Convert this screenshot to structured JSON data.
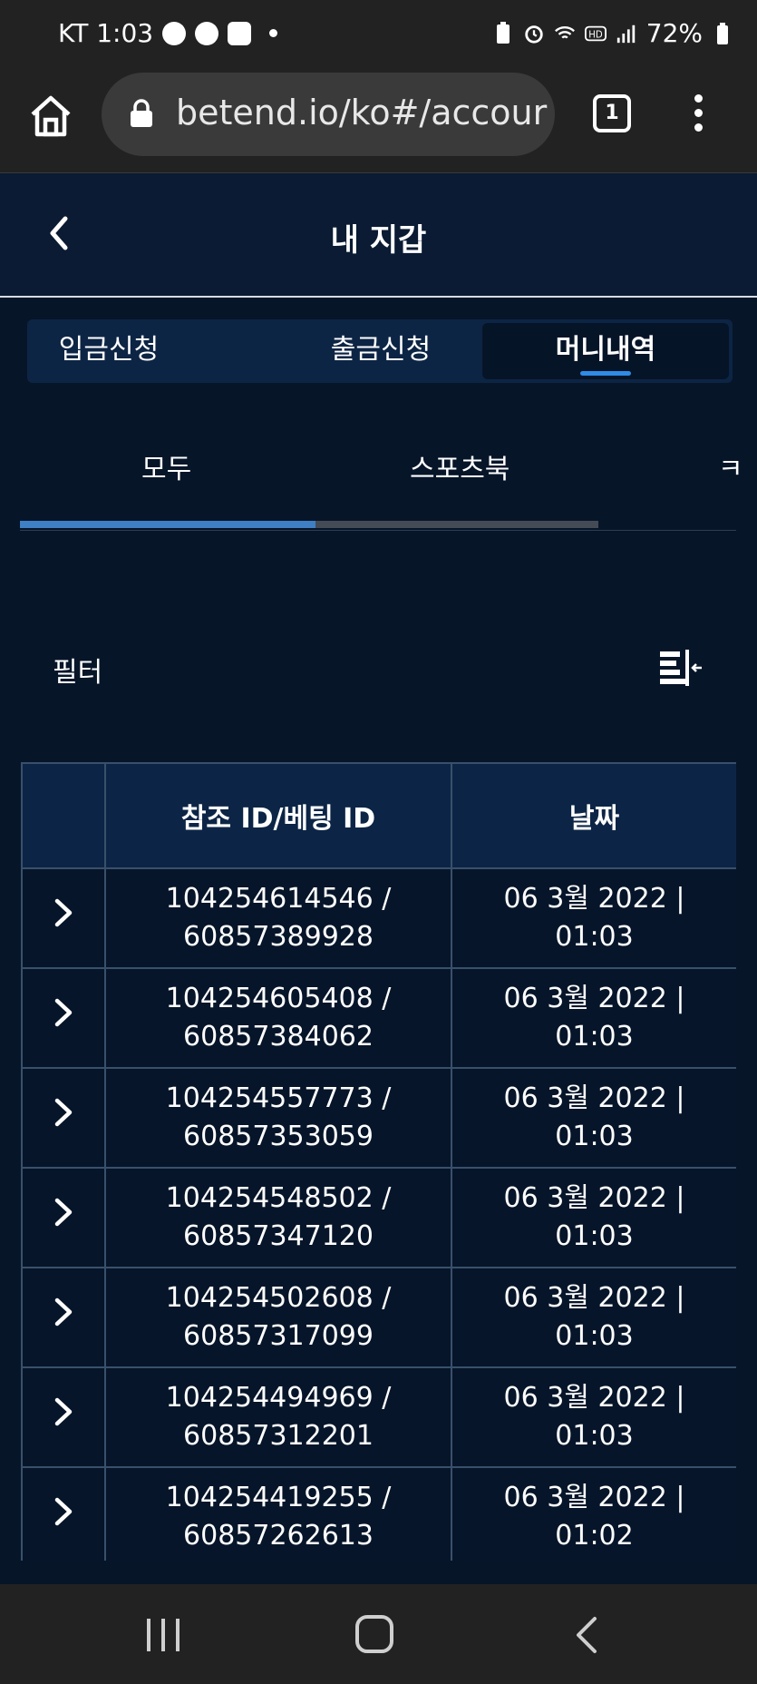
{
  "status_bar": {
    "carrier_time": "KT 1:03",
    "battery": "72%",
    "left_icons": [
      "n-badge-icon",
      "chat-bubble-icon",
      "timer-icon",
      "dot-icon"
    ],
    "right_icons": [
      "battery-saver-icon",
      "alarm-icon",
      "wifi-icon",
      "hd-icon",
      "signal-icon",
      "battery-icon"
    ]
  },
  "browser": {
    "url": "betend.io/ko#/accour",
    "tab_count": "1"
  },
  "header": {
    "title": "내 지갑"
  },
  "main_tabs": [
    {
      "label": "입금신청",
      "active": false
    },
    {
      "label": "출금신청",
      "active": false
    },
    {
      "label": "머니내역",
      "active": true
    }
  ],
  "sub_tabs": [
    {
      "label": "모두",
      "active": true
    },
    {
      "label": "스포츠북",
      "active": false
    },
    {
      "label": "ㅋ",
      "active": false
    }
  ],
  "filter": {
    "label": "필터"
  },
  "table": {
    "headers": [
      "",
      "참조 ID/베팅 ID",
      "날짜"
    ],
    "rows": [
      {
        "ref_id": "104254614546 /",
        "bet_id": "60857389928",
        "date": "06 3월 2022 |",
        "time": "01:03"
      },
      {
        "ref_id": "104254605408 /",
        "bet_id": "60857384062",
        "date": "06 3월 2022 |",
        "time": "01:03"
      },
      {
        "ref_id": "104254557773 /",
        "bet_id": "60857353059",
        "date": "06 3월 2022 |",
        "time": "01:03"
      },
      {
        "ref_id": "104254548502 /",
        "bet_id": "60857347120",
        "date": "06 3월 2022 |",
        "time": "01:03"
      },
      {
        "ref_id": "104254502608 /",
        "bet_id": "60857317099",
        "date": "06 3월 2022 |",
        "time": "01:03"
      },
      {
        "ref_id": "104254494969 /",
        "bet_id": "60857312201",
        "date": "06 3월 2022 |",
        "time": "01:03"
      },
      {
        "ref_id": "104254419255 /",
        "bet_id": "60857262613",
        "date": "06 3월 2022 |",
        "time": "01:02"
      }
    ]
  },
  "colors": {
    "background": "#071529",
    "accent": "#2f8be6",
    "header_cell": "#0c2546"
  }
}
